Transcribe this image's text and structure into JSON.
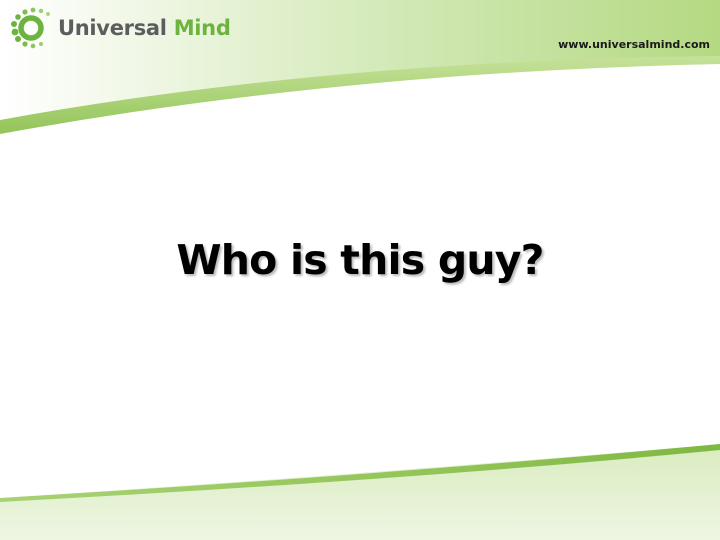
{
  "brand": {
    "name_part1": "Universal",
    "name_part2": "Mind",
    "url": "www.universalmind.com",
    "colors": {
      "green": "#6cb33f",
      "light_green": "#a9d46f",
      "gray": "#5c5d5f"
    },
    "logo_icon": "dotted-circle-logo-icon"
  },
  "slide": {
    "title": "Who is this guy?"
  }
}
